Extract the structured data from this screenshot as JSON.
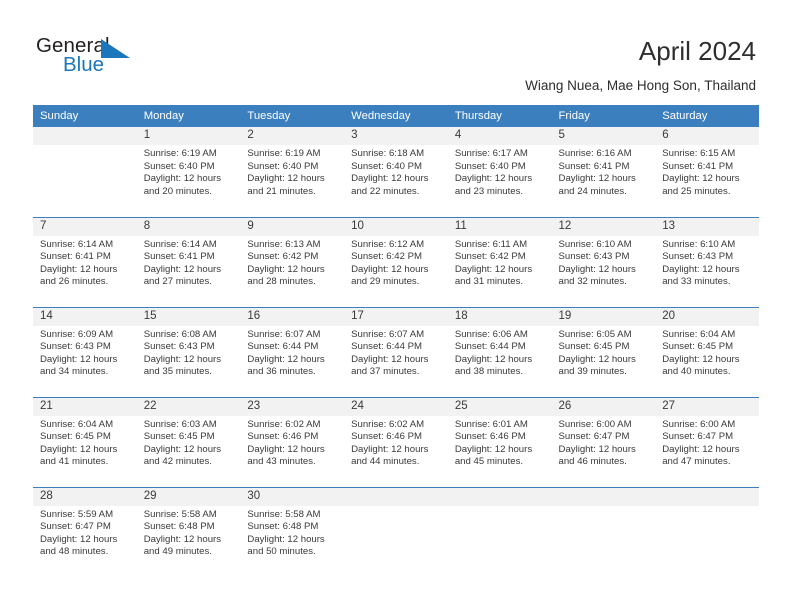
{
  "brand": {
    "word_general": "General",
    "word_blue": "Blue",
    "flag_icon": "blue-triangle-flag-icon",
    "accent_color": "#1b76bb"
  },
  "header": {
    "title": "April 2024",
    "subtitle": "Wiang Nuea, Mae Hong Son, Thailand"
  },
  "calendar": {
    "header_bg": "#3c7fbf",
    "daynum_bg": "#f2f2f2",
    "weekday_headers": [
      "Sunday",
      "Monday",
      "Tuesday",
      "Wednesday",
      "Thursday",
      "Friday",
      "Saturday"
    ],
    "weeks": [
      [
        {
          "day": "",
          "sunrise": "",
          "sunset": "",
          "daylight_line1": "",
          "daylight_line2": ""
        },
        {
          "day": "1",
          "sunrise": "Sunrise: 6:19 AM",
          "sunset": "Sunset: 6:40 PM",
          "daylight_line1": "Daylight: 12 hours",
          "daylight_line2": "and 20 minutes."
        },
        {
          "day": "2",
          "sunrise": "Sunrise: 6:19 AM",
          "sunset": "Sunset: 6:40 PM",
          "daylight_line1": "Daylight: 12 hours",
          "daylight_line2": "and 21 minutes."
        },
        {
          "day": "3",
          "sunrise": "Sunrise: 6:18 AM",
          "sunset": "Sunset: 6:40 PM",
          "daylight_line1": "Daylight: 12 hours",
          "daylight_line2": "and 22 minutes."
        },
        {
          "day": "4",
          "sunrise": "Sunrise: 6:17 AM",
          "sunset": "Sunset: 6:40 PM",
          "daylight_line1": "Daylight: 12 hours",
          "daylight_line2": "and 23 minutes."
        },
        {
          "day": "5",
          "sunrise": "Sunrise: 6:16 AM",
          "sunset": "Sunset: 6:41 PM",
          "daylight_line1": "Daylight: 12 hours",
          "daylight_line2": "and 24 minutes."
        },
        {
          "day": "6",
          "sunrise": "Sunrise: 6:15 AM",
          "sunset": "Sunset: 6:41 PM",
          "daylight_line1": "Daylight: 12 hours",
          "daylight_line2": "and 25 minutes."
        }
      ],
      [
        {
          "day": "7",
          "sunrise": "Sunrise: 6:14 AM",
          "sunset": "Sunset: 6:41 PM",
          "daylight_line1": "Daylight: 12 hours",
          "daylight_line2": "and 26 minutes."
        },
        {
          "day": "8",
          "sunrise": "Sunrise: 6:14 AM",
          "sunset": "Sunset: 6:41 PM",
          "daylight_line1": "Daylight: 12 hours",
          "daylight_line2": "and 27 minutes."
        },
        {
          "day": "9",
          "sunrise": "Sunrise: 6:13 AM",
          "sunset": "Sunset: 6:42 PM",
          "daylight_line1": "Daylight: 12 hours",
          "daylight_line2": "and 28 minutes."
        },
        {
          "day": "10",
          "sunrise": "Sunrise: 6:12 AM",
          "sunset": "Sunset: 6:42 PM",
          "daylight_line1": "Daylight: 12 hours",
          "daylight_line2": "and 29 minutes."
        },
        {
          "day": "11",
          "sunrise": "Sunrise: 6:11 AM",
          "sunset": "Sunset: 6:42 PM",
          "daylight_line1": "Daylight: 12 hours",
          "daylight_line2": "and 31 minutes."
        },
        {
          "day": "12",
          "sunrise": "Sunrise: 6:10 AM",
          "sunset": "Sunset: 6:43 PM",
          "daylight_line1": "Daylight: 12 hours",
          "daylight_line2": "and 32 minutes."
        },
        {
          "day": "13",
          "sunrise": "Sunrise: 6:10 AM",
          "sunset": "Sunset: 6:43 PM",
          "daylight_line1": "Daylight: 12 hours",
          "daylight_line2": "and 33 minutes."
        }
      ],
      [
        {
          "day": "14",
          "sunrise": "Sunrise: 6:09 AM",
          "sunset": "Sunset: 6:43 PM",
          "daylight_line1": "Daylight: 12 hours",
          "daylight_line2": "and 34 minutes."
        },
        {
          "day": "15",
          "sunrise": "Sunrise: 6:08 AM",
          "sunset": "Sunset: 6:43 PM",
          "daylight_line1": "Daylight: 12 hours",
          "daylight_line2": "and 35 minutes."
        },
        {
          "day": "16",
          "sunrise": "Sunrise: 6:07 AM",
          "sunset": "Sunset: 6:44 PM",
          "daylight_line1": "Daylight: 12 hours",
          "daylight_line2": "and 36 minutes."
        },
        {
          "day": "17",
          "sunrise": "Sunrise: 6:07 AM",
          "sunset": "Sunset: 6:44 PM",
          "daylight_line1": "Daylight: 12 hours",
          "daylight_line2": "and 37 minutes."
        },
        {
          "day": "18",
          "sunrise": "Sunrise: 6:06 AM",
          "sunset": "Sunset: 6:44 PM",
          "daylight_line1": "Daylight: 12 hours",
          "daylight_line2": "and 38 minutes."
        },
        {
          "day": "19",
          "sunrise": "Sunrise: 6:05 AM",
          "sunset": "Sunset: 6:45 PM",
          "daylight_line1": "Daylight: 12 hours",
          "daylight_line2": "and 39 minutes."
        },
        {
          "day": "20",
          "sunrise": "Sunrise: 6:04 AM",
          "sunset": "Sunset: 6:45 PM",
          "daylight_line1": "Daylight: 12 hours",
          "daylight_line2": "and 40 minutes."
        }
      ],
      [
        {
          "day": "21",
          "sunrise": "Sunrise: 6:04 AM",
          "sunset": "Sunset: 6:45 PM",
          "daylight_line1": "Daylight: 12 hours",
          "daylight_line2": "and 41 minutes."
        },
        {
          "day": "22",
          "sunrise": "Sunrise: 6:03 AM",
          "sunset": "Sunset: 6:45 PM",
          "daylight_line1": "Daylight: 12 hours",
          "daylight_line2": "and 42 minutes."
        },
        {
          "day": "23",
          "sunrise": "Sunrise: 6:02 AM",
          "sunset": "Sunset: 6:46 PM",
          "daylight_line1": "Daylight: 12 hours",
          "daylight_line2": "and 43 minutes."
        },
        {
          "day": "24",
          "sunrise": "Sunrise: 6:02 AM",
          "sunset": "Sunset: 6:46 PM",
          "daylight_line1": "Daylight: 12 hours",
          "daylight_line2": "and 44 minutes."
        },
        {
          "day": "25",
          "sunrise": "Sunrise: 6:01 AM",
          "sunset": "Sunset: 6:46 PM",
          "daylight_line1": "Daylight: 12 hours",
          "daylight_line2": "and 45 minutes."
        },
        {
          "day": "26",
          "sunrise": "Sunrise: 6:00 AM",
          "sunset": "Sunset: 6:47 PM",
          "daylight_line1": "Daylight: 12 hours",
          "daylight_line2": "and 46 minutes."
        },
        {
          "day": "27",
          "sunrise": "Sunrise: 6:00 AM",
          "sunset": "Sunset: 6:47 PM",
          "daylight_line1": "Daylight: 12 hours",
          "daylight_line2": "and 47 minutes."
        }
      ],
      [
        {
          "day": "28",
          "sunrise": "Sunrise: 5:59 AM",
          "sunset": "Sunset: 6:47 PM",
          "daylight_line1": "Daylight: 12 hours",
          "daylight_line2": "and 48 minutes."
        },
        {
          "day": "29",
          "sunrise": "Sunrise: 5:58 AM",
          "sunset": "Sunset: 6:48 PM",
          "daylight_line1": "Daylight: 12 hours",
          "daylight_line2": "and 49 minutes."
        },
        {
          "day": "30",
          "sunrise": "Sunrise: 5:58 AM",
          "sunset": "Sunset: 6:48 PM",
          "daylight_line1": "Daylight: 12 hours",
          "daylight_line2": "and 50 minutes."
        },
        {
          "day": "",
          "sunrise": "",
          "sunset": "",
          "daylight_line1": "",
          "daylight_line2": ""
        },
        {
          "day": "",
          "sunrise": "",
          "sunset": "",
          "daylight_line1": "",
          "daylight_line2": ""
        },
        {
          "day": "",
          "sunrise": "",
          "sunset": "",
          "daylight_line1": "",
          "daylight_line2": ""
        },
        {
          "day": "",
          "sunrise": "",
          "sunset": "",
          "daylight_line1": "",
          "daylight_line2": ""
        }
      ]
    ]
  }
}
